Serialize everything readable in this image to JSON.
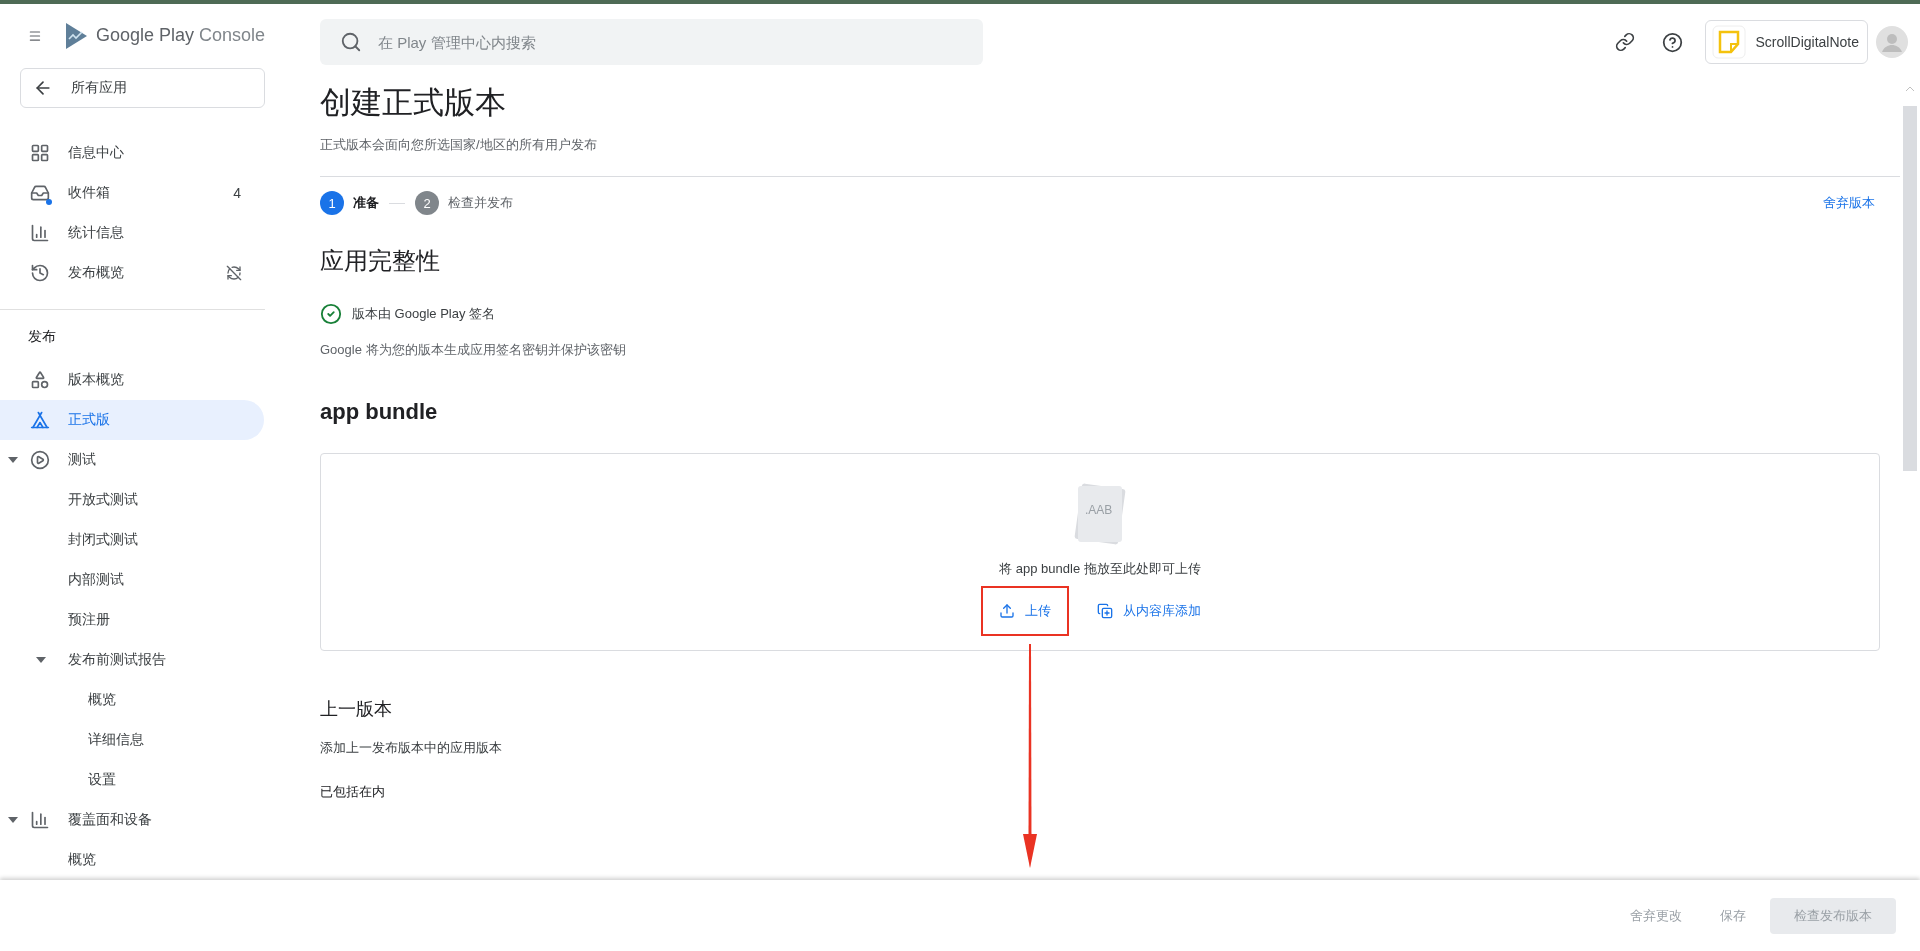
{
  "sidebar": {
    "brand": "Google Play",
    "product": "Console",
    "back_button": "所有应用",
    "items": [
      {
        "label": "信息中心",
        "selected": false
      },
      {
        "label": "收件箱",
        "badge": "4",
        "unread": true,
        "selected": false
      },
      {
        "label": "统计信息",
        "selected": false
      },
      {
        "label": "发布概览",
        "selected": false
      }
    ],
    "section": {
      "title": "发布",
      "items": [
        {
          "label": "版本概览",
          "selected": false
        },
        {
          "label": "正式版",
          "selected": true
        },
        {
          "label": "测试",
          "selected": false,
          "expanded": true,
          "children": [
            {
              "label": "开放式测试",
              "selected": false
            },
            {
              "label": "封闭式测试",
              "selected": false
            },
            {
              "label": "内部测试",
              "selected": false
            },
            {
              "label": "预注册",
              "selected": false
            },
            {
              "label": "发布前测试报告",
              "selected": false,
              "expanded": true,
              "children": [
                {
                  "label": "概览",
                  "selected": false
                },
                {
                  "label": "详细信息",
                  "selected": false
                },
                {
                  "label": "设置",
                  "selected": false
                }
              ]
            }
          ]
        },
        {
          "label": "覆盖面和设备",
          "selected": false,
          "expanded": true,
          "children": [
            {
              "label": "概览",
              "selected": false
            }
          ]
        }
      ]
    }
  },
  "header": {
    "search": {
      "placeholder": "在 Play 管理中心内搜索"
    },
    "app_name": "ScrollDigitalNote"
  },
  "page": {
    "title": "创建正式版本",
    "subtitle": "正式版本会面向您所选国家/地区的所有用户发布",
    "steps": [
      {
        "number": "1",
        "label": "准备",
        "selected": true
      },
      {
        "number": "2",
        "label": "检查并发布",
        "selected": false
      }
    ],
    "discard_link": "舍弃版本",
    "integrity": {
      "heading": "应用完整性",
      "check": "版本由 Google Play 签名",
      "description": "Google 将为您的版本生成应用签名密钥并保护该密钥"
    },
    "bundle": {
      "heading": "app bundle",
      "file_label": ".AAB",
      "drop_text": "将 app bundle 拖放至此处即可上传",
      "actions": [
        {
          "label": "上传",
          "highlighted": true
        },
        {
          "label": "从内容库添加",
          "highlighted": false
        }
      ]
    },
    "previous": {
      "heading": "上一版本",
      "description": "添加上一发布版本中的应用版本",
      "status": "已包括在内"
    }
  },
  "footer": {
    "buttons": [
      {
        "label": "舍弃更改",
        "kind": "text",
        "disabled": true
      },
      {
        "label": "保存",
        "kind": "text",
        "disabled": true
      },
      {
        "label": "检查发布版本",
        "kind": "primary",
        "disabled": true
      }
    ]
  }
}
